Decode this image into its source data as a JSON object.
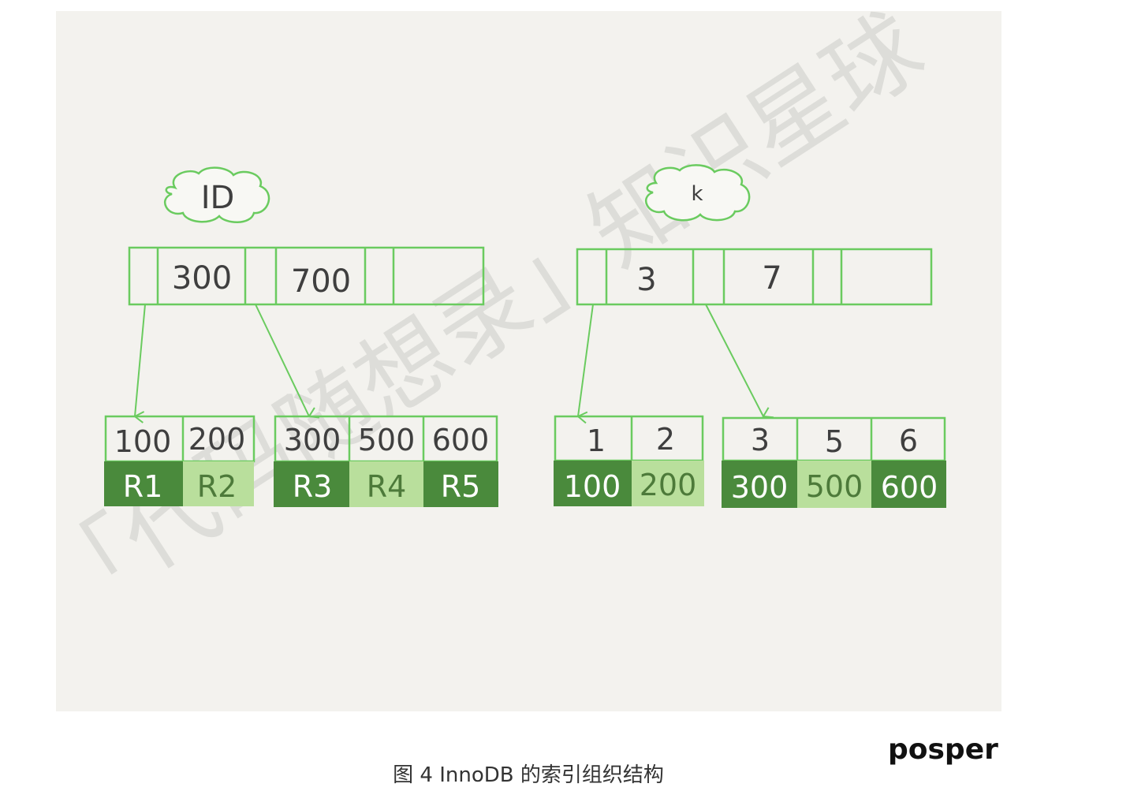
{
  "colors": {
    "panel_bg": "#f3f2ee",
    "line_green": "#6acb5f",
    "dark_green": "#4a8a3c",
    "light_green": "#b9df9c",
    "text_dark": "#3f3f3f"
  },
  "primary_index": {
    "label": "ID",
    "root_keys": [
      "300",
      "700"
    ],
    "leaf_pages": [
      {
        "keys": [
          "100",
          "200"
        ],
        "values": [
          "R1",
          "R2"
        ]
      },
      {
        "keys": [
          "300",
          "500",
          "600"
        ],
        "values": [
          "R3",
          "R4",
          "R5"
        ]
      }
    ]
  },
  "secondary_index": {
    "label": "k",
    "root_keys": [
      "3",
      "7"
    ],
    "leaf_pages": [
      {
        "keys": [
          "1",
          "2"
        ],
        "values": [
          "100",
          "200"
        ]
      },
      {
        "keys": [
          "3",
          "5",
          "6"
        ],
        "values": [
          "300",
          "500",
          "600"
        ]
      }
    ]
  },
  "watermark": "「代码随想录」知识星球",
  "caption": "图 4 InnoDB 的索引组织结构",
  "author": "posper"
}
